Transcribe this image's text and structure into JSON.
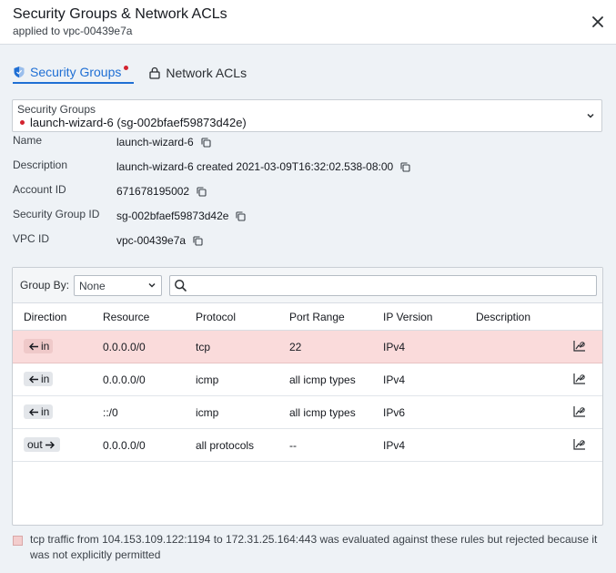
{
  "header": {
    "title": "Security Groups & Network ACLs",
    "subtitle": "applied to vpc-00439e7a"
  },
  "tabs": [
    {
      "label": "Security Groups",
      "active": true,
      "has_alert": true
    },
    {
      "label": "Network ACLs",
      "active": false
    }
  ],
  "sg_select": {
    "label": "Security Groups",
    "value": "launch-wizard-6 (sg-002bfaef59873d42e)"
  },
  "details": [
    {
      "label": "Name",
      "value": "launch-wizard-6"
    },
    {
      "label": "Description",
      "value": "launch-wizard-6 created 2021-03-09T16:32:02.538-08:00"
    },
    {
      "label": "Account ID",
      "value": "671678195002"
    },
    {
      "label": "Security Group ID",
      "value": "sg-002bfaef59873d42e"
    },
    {
      "label": "VPC ID",
      "value": "vpc-00439e7a"
    }
  ],
  "toolbar": {
    "group_by_label": "Group By:",
    "group_by_value": "None",
    "search_placeholder": ""
  },
  "table": {
    "columns": [
      "Direction",
      "Resource",
      "Protocol",
      "Port Range",
      "IP Version",
      "Description"
    ],
    "rows": [
      {
        "direction": "in",
        "resource": "0.0.0.0/0",
        "protocol": "tcp",
        "port_range": "22",
        "ip_version": "IPv4",
        "description": "",
        "rejected": true
      },
      {
        "direction": "in",
        "resource": "0.0.0.0/0",
        "protocol": "icmp",
        "port_range": "all icmp types",
        "ip_version": "IPv4",
        "description": "",
        "rejected": false
      },
      {
        "direction": "in",
        "resource": "::/0",
        "protocol": "icmp",
        "port_range": "all icmp types",
        "ip_version": "IPv6",
        "description": "",
        "rejected": false
      },
      {
        "direction": "out",
        "resource": "0.0.0.0/0",
        "protocol": "all protocols",
        "port_range": "--",
        "ip_version": "IPv4",
        "description": "",
        "rejected": false
      }
    ]
  },
  "legend": {
    "text": "tcp traffic from 104.153.109.122:1194 to 172.31.25.164:443 was evaluated against these rules but rejected because it was not explicitly permitted"
  },
  "colors": {
    "accent": "#1f6fd4",
    "alert": "#d3232f",
    "rejected_row": "#fadbdb"
  }
}
